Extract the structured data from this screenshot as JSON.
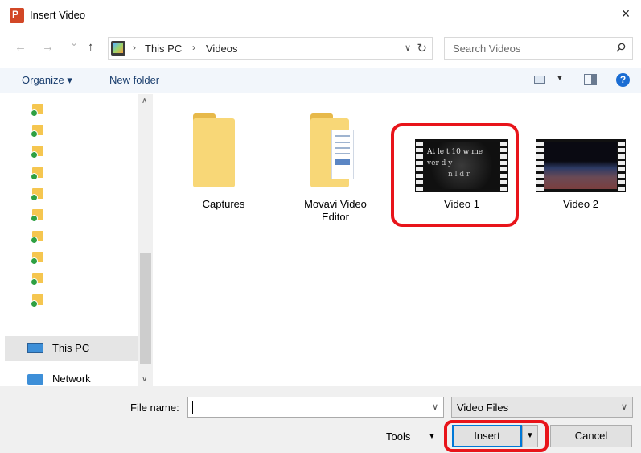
{
  "window": {
    "title": "Insert Video",
    "close_glyph": "×"
  },
  "nav": {
    "back_glyph": "←",
    "forward_glyph": "→",
    "recent_glyph": "⌄",
    "up_glyph": "↑",
    "breadcrumb": [
      "This PC",
      "Videos"
    ],
    "sep_glyph": "›",
    "dropdown_glyph": "∨",
    "refresh_glyph": "↻",
    "search_placeholder": "Search Videos"
  },
  "toolbar": {
    "organize_label": "Organize ▾",
    "new_folder_label": "New folder",
    "view_dropdown_glyph": "▼",
    "help_glyph": "?"
  },
  "navpane": {
    "folder_count": 10,
    "this_pc_label": "This PC",
    "network_label": "Network",
    "scroll_up_glyph": "∧",
    "scroll_down_glyph": "∨"
  },
  "files": [
    {
      "name": "Captures",
      "kind": "folder"
    },
    {
      "name": "Movavi Video Editor",
      "kind": "folder-docs"
    },
    {
      "name": "Video 1",
      "kind": "video"
    },
    {
      "name": "Video 2",
      "kind": "video"
    }
  ],
  "bottom": {
    "file_name_label": "File name:",
    "file_name_value": "",
    "file_name_dd_glyph": "∨",
    "file_type_value": "Video Files",
    "file_type_dd_glyph": "∨",
    "tools_label": "Tools",
    "tools_dd_glyph": "▼",
    "insert_label": "Insert",
    "insert_dd_glyph": "▼",
    "cancel_label": "Cancel"
  },
  "colors": {
    "highlight": "#e8141a",
    "folder": "#f8d777",
    "toolbar_bg": "#f2f6fb",
    "accent": "#0078d7"
  }
}
